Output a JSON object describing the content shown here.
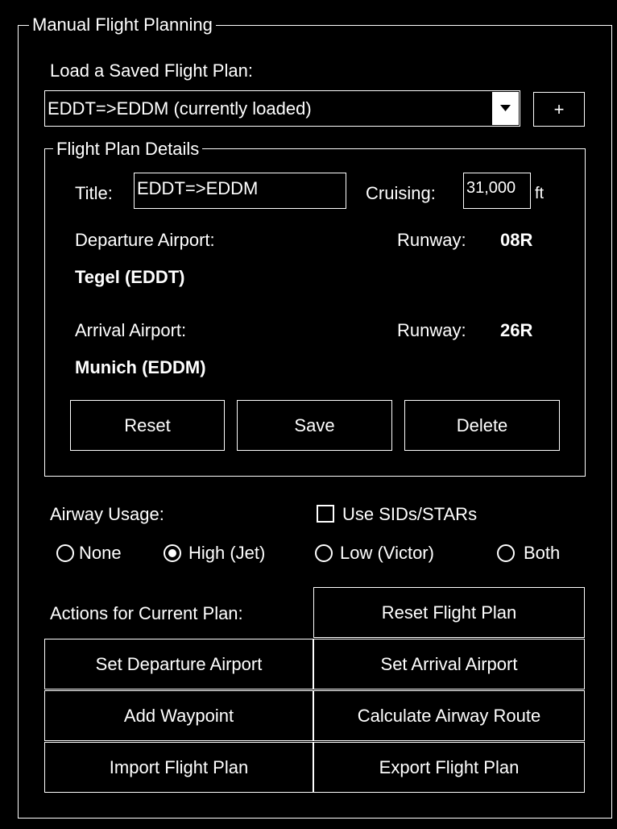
{
  "panel": {
    "title": "Manual Flight Planning",
    "load_label": "Load a Saved Flight Plan:",
    "saved_plan_selected": "EDDT=>EDDM (currently loaded)",
    "add_button": "+"
  },
  "details": {
    "title": "Flight Plan Details",
    "title_label": "Title:",
    "title_value": "EDDT=>EDDM",
    "cruising_label": "Cruising:",
    "cruising_value": "31,000",
    "cruising_unit": "ft",
    "departure_label": "Departure Airport:",
    "departure_runway_label": "Runway:",
    "departure_runway": "08R",
    "departure_airport": "Tegel (EDDT)",
    "arrival_label": "Arrival Airport:",
    "arrival_runway_label": "Runway:",
    "arrival_runway": "26R",
    "arrival_airport": "Munich (EDDM)",
    "buttons": {
      "reset": "Reset",
      "save": "Save",
      "delete": "Delete"
    }
  },
  "airway": {
    "label": "Airway Usage:",
    "sid_star_label": "Use SIDs/STARs",
    "sid_star_checked": false,
    "options": [
      "None",
      "High (Jet)",
      "Low (Victor)",
      "Both"
    ],
    "selected": "High (Jet)"
  },
  "actions": {
    "label": "Actions for Current Plan:",
    "reset_plan": "Reset Flight Plan",
    "set_departure": "Set Departure Airport",
    "set_arrival": "Set Arrival Airport",
    "add_waypoint": "Add Waypoint",
    "calculate_route": "Calculate Airway Route",
    "import_plan": "Import Flight Plan",
    "export_plan": "Export Flight Plan"
  }
}
